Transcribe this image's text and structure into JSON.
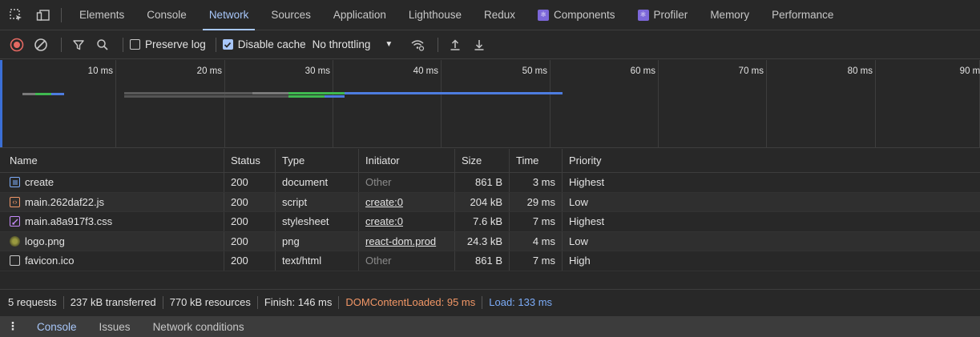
{
  "tabs": [
    {
      "label": "Elements",
      "active": false
    },
    {
      "label": "Console",
      "active": false
    },
    {
      "label": "Network",
      "active": true
    },
    {
      "label": "Sources",
      "active": false
    },
    {
      "label": "Application",
      "active": false
    },
    {
      "label": "Lighthouse",
      "active": false
    },
    {
      "label": "Redux",
      "active": false
    },
    {
      "label": "Components",
      "active": false
    },
    {
      "label": "Profiler",
      "active": false
    },
    {
      "label": "Memory",
      "active": false
    },
    {
      "label": "Performance",
      "active": false
    }
  ],
  "toolbar": {
    "preserve_log_label": "Preserve log",
    "preserve_log_checked": false,
    "disable_cache_label": "Disable cache",
    "disable_cache_checked": true,
    "throttling_value": "No throttling"
  },
  "timeline": {
    "ticks": [
      "10 ms",
      "20 ms",
      "30 ms",
      "40 ms",
      "50 ms",
      "60 ms",
      "70 ms",
      "80 ms",
      "90 ms"
    ]
  },
  "table": {
    "headers": {
      "name": "Name",
      "status": "Status",
      "type": "Type",
      "initiator": "Initiator",
      "size": "Size",
      "time": "Time",
      "priority": "Priority"
    },
    "rows": [
      {
        "name": "create",
        "icon": "document-icon",
        "status": "200",
        "type": "document",
        "initiator": "Other",
        "size": "861 B",
        "time": "3 ms",
        "priority": "Highest"
      },
      {
        "name": "main.262daf22.js",
        "icon": "script-icon",
        "status": "200",
        "type": "script",
        "initiator": "create:0",
        "size": "204 kB",
        "time": "29 ms",
        "priority": "Low"
      },
      {
        "name": "main.a8a917f3.css",
        "icon": "stylesheet-icon",
        "status": "200",
        "type": "stylesheet",
        "initiator": "create:0",
        "size": "7.6 kB",
        "time": "7 ms",
        "priority": "Highest"
      },
      {
        "name": "logo.png",
        "icon": "image-icon",
        "status": "200",
        "type": "png",
        "initiator": "react-dom.prod",
        "size": "24.3 kB",
        "time": "4 ms",
        "priority": "Low"
      },
      {
        "name": "favicon.ico",
        "icon": "file-icon",
        "status": "200",
        "type": "text/html",
        "initiator": "Other",
        "size": "861 B",
        "time": "7 ms",
        "priority": "High"
      }
    ]
  },
  "summary": {
    "requests": "5 requests",
    "transferred": "237 kB transferred",
    "resources": "770 kB resources",
    "finish": "Finish: 146 ms",
    "dom_content_loaded": "DOMContentLoaded: 95 ms",
    "load": "Load: 133 ms"
  },
  "drawer": {
    "tabs": [
      "Console",
      "Issues",
      "Network conditions"
    ]
  },
  "colors": {
    "accent": "#a8c7fa",
    "dom_content_loaded": "#f29766",
    "load": "#7cacf8",
    "record_red": "#e46962"
  }
}
